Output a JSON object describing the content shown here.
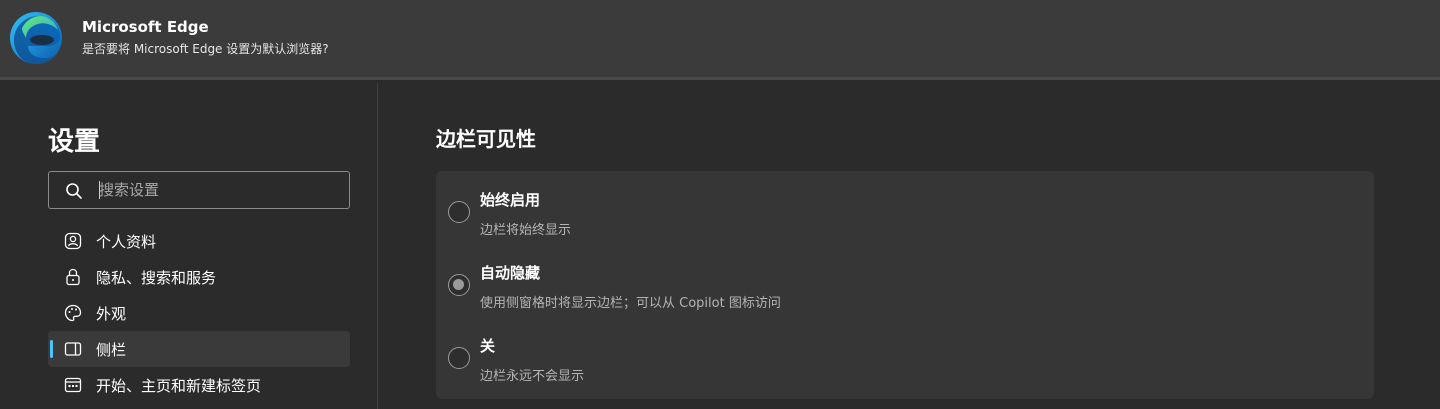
{
  "banner": {
    "title": "Microsoft Edge",
    "subtitle": "是否要将 Microsoft Edge 设置为默认浏览器?",
    "logo_icon": "edge-logo-icon"
  },
  "sidebar": {
    "title": "设置",
    "search": {
      "placeholder": "搜索设置",
      "value": ""
    },
    "items": [
      {
        "label": "个人资料",
        "icon": "profile-icon",
        "active": false
      },
      {
        "label": "隐私、搜索和服务",
        "icon": "lock-icon",
        "active": false
      },
      {
        "label": "外观",
        "icon": "palette-icon",
        "active": false
      },
      {
        "label": "侧栏",
        "icon": "sidebar-icon",
        "active": true
      },
      {
        "label": "开始、主页和新建标签页",
        "icon": "new-tab-icon",
        "active": false
      }
    ]
  },
  "main": {
    "section_title": "边栏可见性",
    "options": [
      {
        "title": "始终启用",
        "description": "边栏将始终显示",
        "selected": false
      },
      {
        "title": "自动隐藏",
        "description": "使用侧窗格时将显示边栏；可以从 Copilot 图标访问",
        "selected": true
      },
      {
        "title": "关",
        "description": "边栏永远不会显示",
        "selected": false
      }
    ]
  },
  "colors": {
    "accent": "#4cc2ff",
    "background": "#2b2b2b",
    "banner": "#3b3b3b",
    "card": "#363636"
  }
}
